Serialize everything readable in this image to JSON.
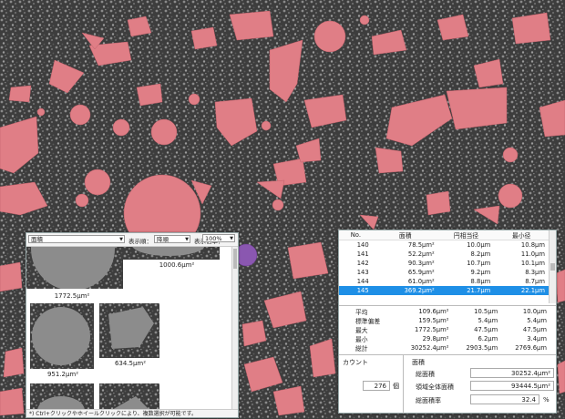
{
  "toolbar": {
    "measure_value": "面積",
    "order_label": "表示順：",
    "order_value": "降順",
    "zoom_label": "表示倍率：",
    "zoom_value": "100%"
  },
  "gallery": {
    "captions": [
      "1000.6μm²",
      "1772.5μm²",
      "951.2μm²",
      "634.5μm²"
    ],
    "footer": "*) Ctrl+クリックやホイールクリックにより、複数選択が可能です。"
  },
  "table": {
    "headers": [
      "No.",
      "面積",
      "円相当径",
      "最小径"
    ],
    "rows": [
      [
        "140",
        "78.5μm²",
        "10.0μm",
        "10.8μm"
      ],
      [
        "141",
        "52.2μm²",
        "8.2μm",
        "11.0μm"
      ],
      [
        "142",
        "90.3μm²",
        "10.7μm",
        "10.1μm"
      ],
      [
        "143",
        "65.9μm²",
        "9.2μm",
        "8.3μm"
      ],
      [
        "144",
        "61.0μm²",
        "8.8μm",
        "8.7μm"
      ],
      [
        "145",
        "369.2μm²",
        "21.7μm",
        "22.1μm"
      ]
    ],
    "selected_row": 5
  },
  "stats": [
    [
      "平均",
      "109.6μm²",
      "10.5μm",
      "10.0μm"
    ],
    [
      "標準偏差",
      "159.5μm²",
      "5.4μm",
      "5.4μm"
    ],
    [
      "最大",
      "1772.5μm²",
      "47.5μm",
      "47.5μm"
    ],
    [
      "最小",
      "29.8μm²",
      "6.2μm",
      "3.4μm"
    ],
    [
      "総計",
      "30252.4μm²",
      "2903.5μm",
      "2769.6μm"
    ]
  ],
  "summary": {
    "count_label": "カウント",
    "count_value": "276",
    "count_unit": "個",
    "area_label": "面積",
    "total_area_label": "総面積",
    "total_area_value": "30252.4μm²",
    "field_area_label": "領域全体面積",
    "field_area_value": "93444.5μm²",
    "area_ratio_label": "総面積率",
    "area_ratio_value": "32.4",
    "area_ratio_unit": "%"
  },
  "colors": {
    "particle": "#e07e86",
    "particle_highlight": "#8a57b0",
    "selection": "#1e8fe6",
    "background": "#3a3a3a"
  }
}
